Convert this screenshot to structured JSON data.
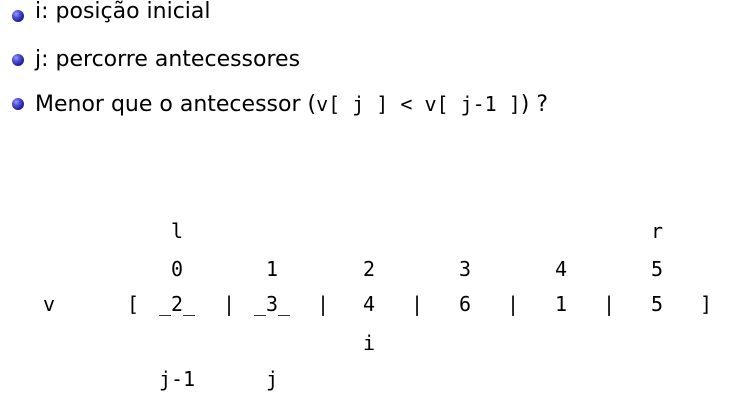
{
  "bullets": [
    {
      "text": "i: posição inicial"
    },
    {
      "text": "j: percorre antecessores"
    },
    {
      "prefix": "Menor que o antecessor (",
      "code": "v[ j ] < v[ j-1 ]",
      "suffix": ") ?"
    }
  ],
  "diagram": {
    "pointer_l": "l",
    "pointer_r": "r",
    "indices": [
      "0",
      "1",
      "2",
      "3",
      "4",
      "5"
    ],
    "array_name": "v",
    "open_bracket": "[",
    "close_bracket": "]",
    "separator": "|",
    "values": [
      "_2_",
      "_3_",
      "4",
      "6",
      "1",
      "5"
    ],
    "pointer_i": "i",
    "pointer_jm1": "j-1",
    "pointer_j": "j"
  }
}
